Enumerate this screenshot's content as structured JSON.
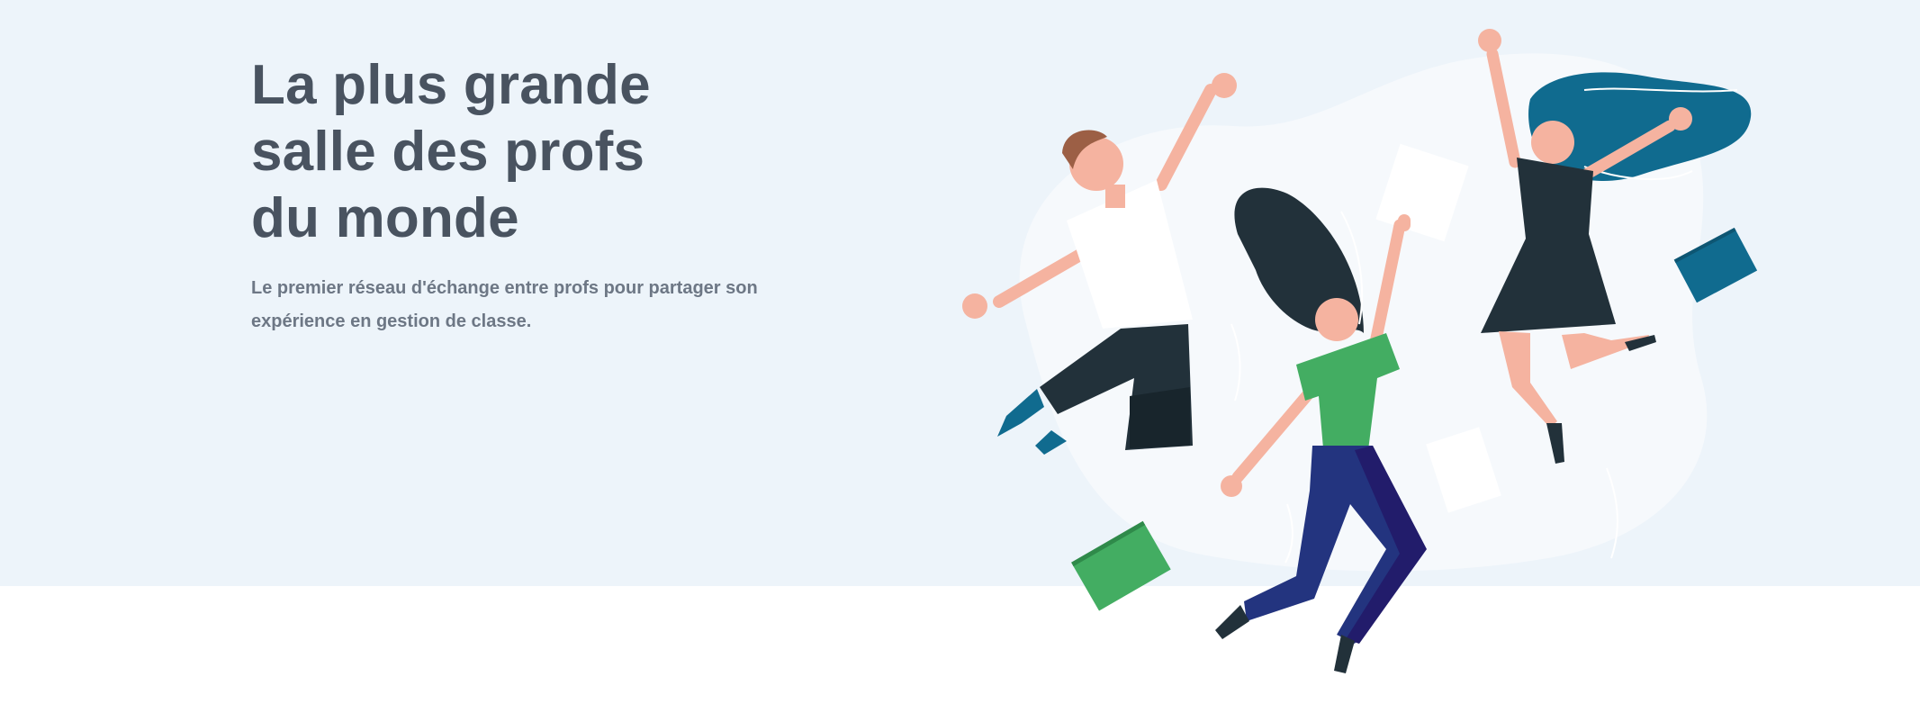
{
  "hero": {
    "title": "La plus grande\nsalle des profs\ndu monde",
    "subtitle": "Le premier réseau d'échange entre profs pour partager son expérience en gestion de classe."
  },
  "colors": {
    "band": "#edf4fa",
    "title": "#495360",
    "subtitle": "#6d7785",
    "teal": "#106b8f",
    "green": "#43ad62",
    "navy": "#23347f",
    "dark": "#22313a"
  },
  "illustration": {
    "icon": "jumping-teachers-illustration"
  }
}
